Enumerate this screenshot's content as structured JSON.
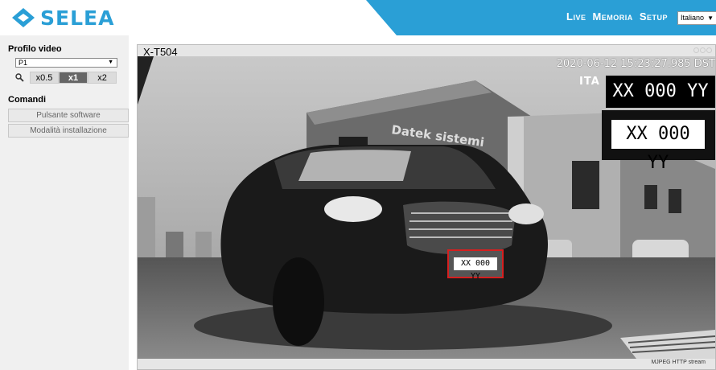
{
  "brand": {
    "name": "SELEA",
    "color": "#2a9fd6"
  },
  "nav": {
    "items": [
      "Live",
      "Memoria",
      "Setup"
    ],
    "language": "Italiano"
  },
  "sidebar": {
    "video_profile_title": "Profilo video",
    "profile_selected": "P1",
    "zoom_options": [
      "x0.5",
      "x1",
      "x2"
    ],
    "zoom_active": "x1",
    "commands_title": "Comandi",
    "buttons": [
      "Pulsante software",
      "Modalità installazione"
    ]
  },
  "viewer": {
    "title": "X-T504",
    "timestamp": "2020-06-12 15:23:27.985 DST",
    "country": "ITA",
    "plate_text": "XX 000 YY",
    "plate_text_crop": "XX 000 YY",
    "plate_text_small": "XX 000 YY",
    "building_sign": "Datek sistemi",
    "stream_label": "MJPEG HTTP stream"
  },
  "icons": {
    "zoom": "magnifier-icon",
    "logo": "selea-diamond-icon"
  }
}
